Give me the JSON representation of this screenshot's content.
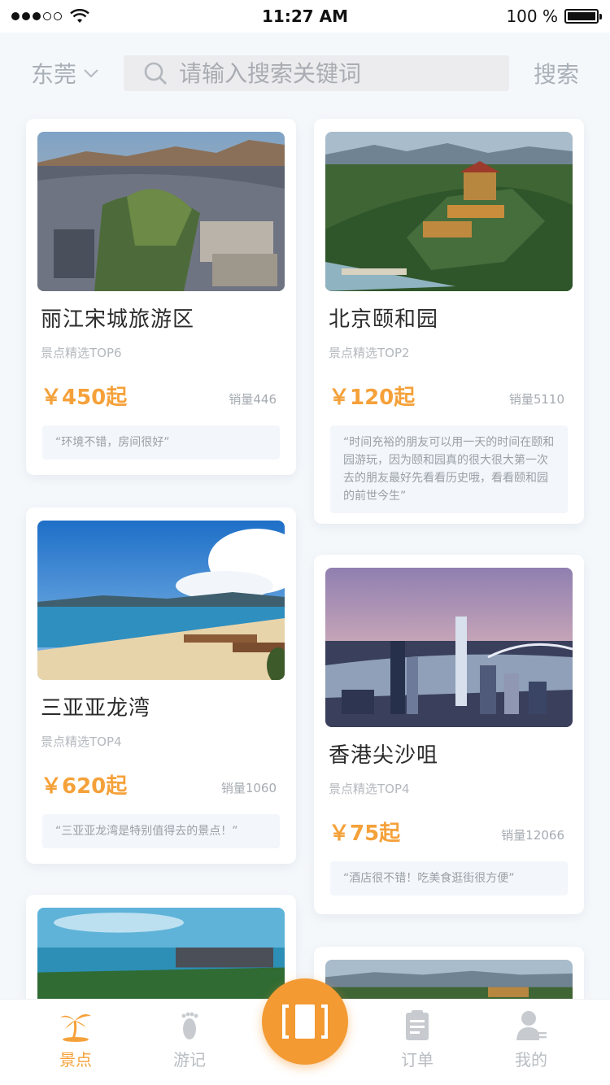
{
  "status_bar": {
    "time": "11:27 AM",
    "battery_text": "100 %",
    "battery_level": 1.0,
    "signal_bars_filled": 3,
    "signal_bars_total": 5
  },
  "header": {
    "city": "东莞",
    "search_placeholder": "请输入搜索关键词",
    "search_button": "搜索"
  },
  "cards": [
    {
      "title": "丽江宋城旅游区",
      "subtitle": "景点精选TOP6",
      "price": "￥450起",
      "sales": "销量446",
      "review": "“环境不错，房间很好”"
    },
    {
      "title": "北京颐和园",
      "subtitle": "景点精选TOP2",
      "price": "￥120起",
      "sales": "销量5110",
      "review": "“时间充裕的朋友可以用一天的时间在颐和园游玩，因为颐和园真的很大很大第一次去的朋友最好先看看历史哦，看看颐和园的前世今生”"
    },
    {
      "title": "三亚亚龙湾",
      "subtitle": "景点精选TOP4",
      "price": "￥620起",
      "sales": "销量1060",
      "review": "“三亚亚龙湾是特别值得去的景点！”"
    },
    {
      "title": "香港尖沙咀",
      "subtitle": "景点精选TOP4",
      "price": "￥75起",
      "sales": "销量12066",
      "review": "“酒店很不错！吃美食逛街很方便”"
    }
  ],
  "tabbar": {
    "tabs": [
      {
        "label": "景点",
        "icon": "palm-tree-icon",
        "active": true
      },
      {
        "label": "游记",
        "icon": "footprint-icon",
        "active": false
      },
      {
        "label": "订单",
        "icon": "clipboard-icon",
        "active": false
      },
      {
        "label": "我的",
        "icon": "user-icon",
        "active": false
      }
    ],
    "center_icon": "scan-icon"
  },
  "colors": {
    "accent": "#f39a33",
    "price": "#f5a13a",
    "background": "#f5f8fb"
  }
}
